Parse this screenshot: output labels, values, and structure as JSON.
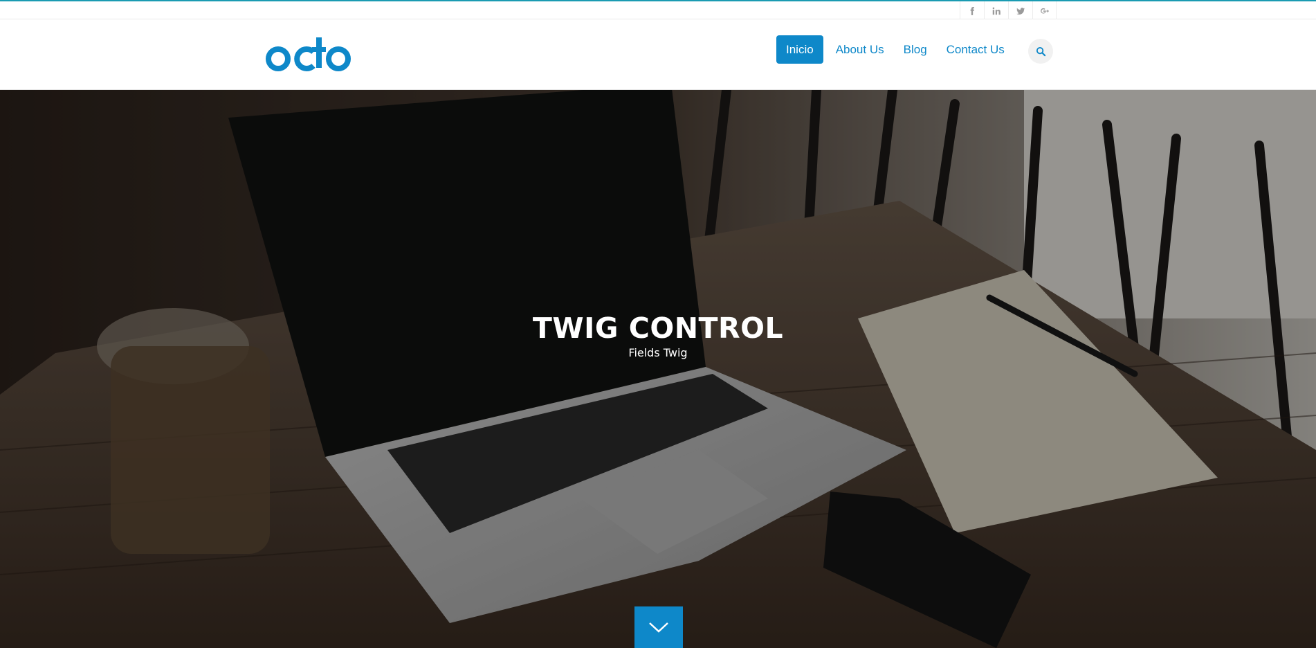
{
  "social": {
    "icons": [
      "facebook-icon",
      "linkedin-icon",
      "twitter-icon",
      "google-plus-icon"
    ]
  },
  "brand": {
    "logo_text": "octo",
    "color": "#0e88c9"
  },
  "nav": {
    "items": [
      {
        "label": "Inicio",
        "active": true
      },
      {
        "label": "About Us",
        "active": false
      },
      {
        "label": "Blog",
        "active": false
      },
      {
        "label": "Contact Us",
        "active": false
      }
    ],
    "search_icon": "search-icon"
  },
  "hero": {
    "title": "TWIG CONTROL",
    "subtitle": "Fields Twig",
    "scroll_icon": "chevron-down-icon"
  },
  "colors": {
    "accent": "#0e88c9",
    "topbar_border": "#1a9bb2"
  }
}
